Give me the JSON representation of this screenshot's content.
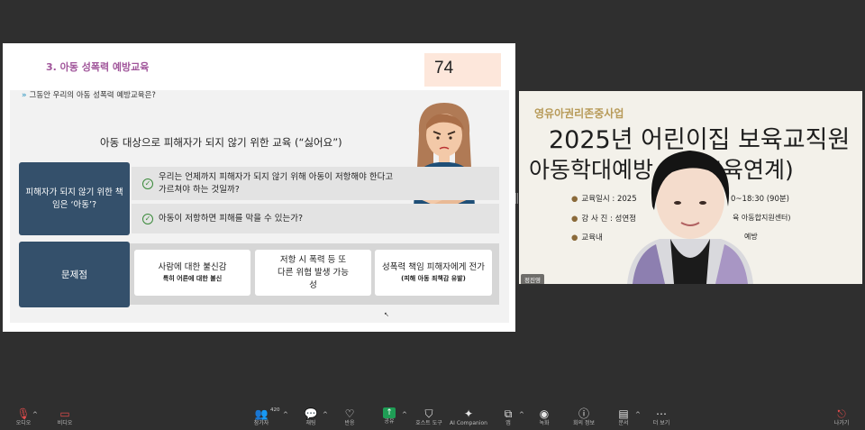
{
  "slide": {
    "title": "3. 아동 성폭력 예방교육",
    "page_number": "74",
    "question": "그동안 우리의 아동 성폭력 예방교육은?",
    "question_marker": "»",
    "headline": "아동 대상으로 피해자가 되지 않기 위한 교육 (“싫어요”)",
    "responsibility_label": "피해자가 되지 않기 위한 책임은 ‘아동’?",
    "check_rows": [
      "우리는 언제까지 피해자가 되지 않기 위해 아동이 저항해야 한다고 가르쳐야 하는 것일까?",
      "아동이 저항하면 피해를 막을 수 있는가?"
    ],
    "problem_label": "문제점",
    "problem_cards": [
      {
        "main": "사람에 대한 불신감",
        "sub": "특히 어른에 대한 불신"
      },
      {
        "main": "저항 시 폭력 등 또다른 위협 발생 가능성",
        "sub": ""
      },
      {
        "main": "성폭력 책임 피해자에게 전가",
        "sub": "(피해 아동 죄책감 유발)"
      }
    ]
  },
  "video": {
    "org": "영유아권리존중사업",
    "title_line1": "2025년 어린이집 보육교직원",
    "title_line2": "아동학대예방      보수교육연계)",
    "info_rows": [
      {
        "label": "교육일시 : 2025",
        "right": "0~18:30 (90분)"
      },
      {
        "label": "강 사 진 : 성연정",
        "right": "육 아동합지원센터)"
      },
      {
        "label": "교육내",
        "right": "예방"
      }
    ],
    "name_tag": "정진영"
  },
  "toolbar": {
    "items": [
      {
        "id": "audio",
        "icon": "mic-muted-icon",
        "glyph": "🎙",
        "label": "오디오"
      },
      {
        "id": "video",
        "icon": "video-off-icon",
        "glyph": "▭",
        "label": "비디오"
      },
      {
        "id": "participants",
        "icon": "participants-icon",
        "glyph": "👥",
        "label": "참가자"
      },
      {
        "id": "chat",
        "icon": "chat-icon",
        "glyph": "💬",
        "label": "채팅"
      },
      {
        "id": "react",
        "icon": "heart-icon",
        "glyph": "♡",
        "label": "반응"
      },
      {
        "id": "share",
        "icon": "share-screen-icon",
        "glyph": "↑",
        "label": "공유"
      },
      {
        "id": "host-tools",
        "icon": "shield-icon",
        "glyph": "⛉",
        "label": "호스트 도구"
      },
      {
        "id": "ai",
        "icon": "sparkle-icon",
        "glyph": "✦",
        "label": "AI Companion"
      },
      {
        "id": "apps",
        "icon": "apps-icon",
        "glyph": "⧉",
        "label": "앱"
      },
      {
        "id": "record",
        "icon": "record-icon",
        "glyph": "◉",
        "label": "녹화"
      },
      {
        "id": "meeting-info",
        "icon": "info-icon",
        "glyph": "ⓘ",
        "label": "회의 정보"
      },
      {
        "id": "docs",
        "icon": "document-icon",
        "glyph": "▤",
        "label": "문서"
      },
      {
        "id": "more",
        "icon": "more-icon",
        "glyph": "⋯",
        "label": "더 보기"
      },
      {
        "id": "leave",
        "icon": "leave-icon",
        "glyph": "⎋",
        "label": "나가기"
      }
    ],
    "participant_count": "420"
  },
  "colors": {
    "background": "#2f2f2f",
    "slide_accent": "#a0559a",
    "navy": "#34506b",
    "page_box": "#fde7db",
    "share_green": "#1f9d55",
    "muted_red": "#e24b4b"
  }
}
